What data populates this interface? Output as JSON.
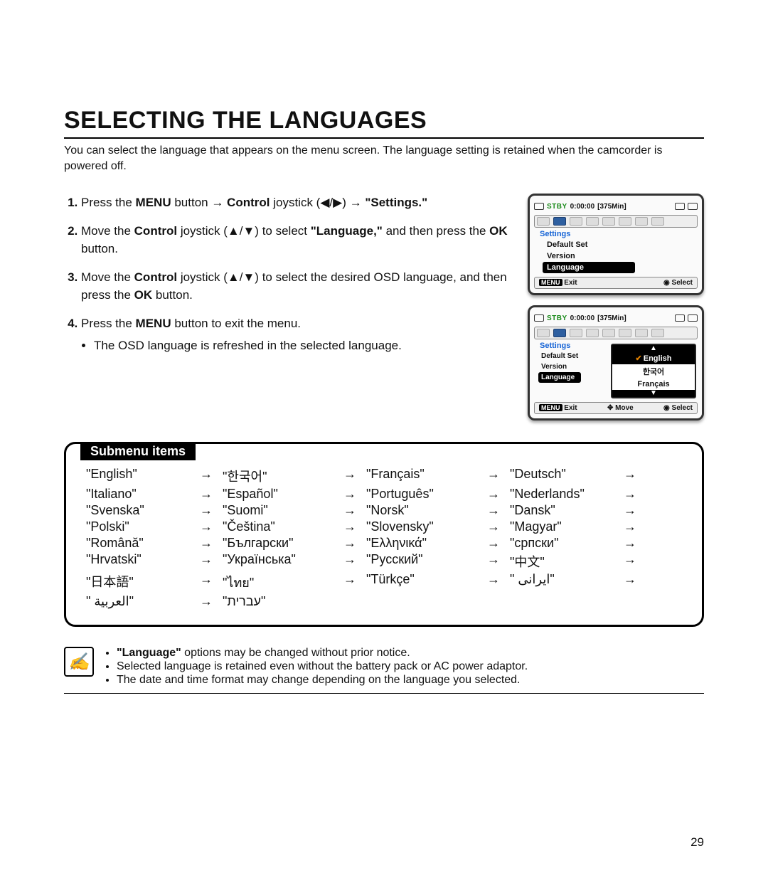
{
  "title": "SELECTING THE LANGUAGES",
  "intro": "You can select the language that appears on the menu screen. The language setting is retained when the camcorder is powered off.",
  "steps": {
    "s1_a": "Press the ",
    "s1_menu": "MENU",
    "s1_b": " button → ",
    "s1_control": "Control",
    "s1_c": " joystick (◀/▶) → ",
    "s1_settings": "\"Settings.\"",
    "s2_a": "Move the ",
    "s2_control": "Control",
    "s2_b": " joystick (▲/▼) to select ",
    "s2_lang": "\"Language,\"",
    "s2_c": " and then press the ",
    "s2_ok": "OK",
    "s2_d": " button.",
    "s3_a": "Move the ",
    "s3_control": "Control",
    "s3_b": " joystick (▲/▼) to select the desired OSD language, and then press the ",
    "s3_ok": "OK",
    "s3_c": " button.",
    "s4_a": "Press the ",
    "s4_menu": "MENU",
    "s4_b": " button to exit the menu.",
    "s4_bullet": "The OSD language is refreshed in the selected language."
  },
  "lcd": {
    "stby": "STBY",
    "tc": "0:00:00",
    "remain": "[375Min]",
    "settings": "Settings",
    "rows": [
      "Default Set",
      "Version",
      "Language"
    ],
    "bottom_menu": "MENU",
    "exit": "Exit",
    "move": "Move",
    "select": "Select",
    "popup": [
      "English",
      "한국어",
      "Français"
    ]
  },
  "submenu": {
    "tab": "Submenu items",
    "items": [
      "\"English\"",
      "\"한국어\"",
      "\"Français\"",
      "\"Deutsch\"",
      "\"Italiano\"",
      "\"Español\"",
      "\"Português\"",
      "\"Nederlands\"",
      "\"Svenska\"",
      "\"Suomi\"",
      "\"Norsk\"",
      "\"Dansk\"",
      "\"Polski\"",
      "\"Čeština\"",
      "\"Slovensky\"",
      "\"Magyar\"",
      "\"Română\"",
      "\"Български\"",
      "\"Ελληνικά\"",
      "\"српски\"",
      "\"Hrvatski\"",
      "\"Українська\"",
      "\"Русский\"",
      "\"中文\"",
      "\"日本語\"",
      "\"ไทย\"",
      "\"Türkçe\"",
      "\" ایرانی\"",
      "\" العربية\"",
      "\"עברית\""
    ],
    "arrow": "→"
  },
  "notes": {
    "n1_a": "\"Language\"",
    "n1_b": " options may be changed without prior notice.",
    "n2": "Selected language is retained even without the battery pack or AC power adaptor.",
    "n3": "The date and time format may change depending on the language you selected."
  },
  "page_number": "29"
}
